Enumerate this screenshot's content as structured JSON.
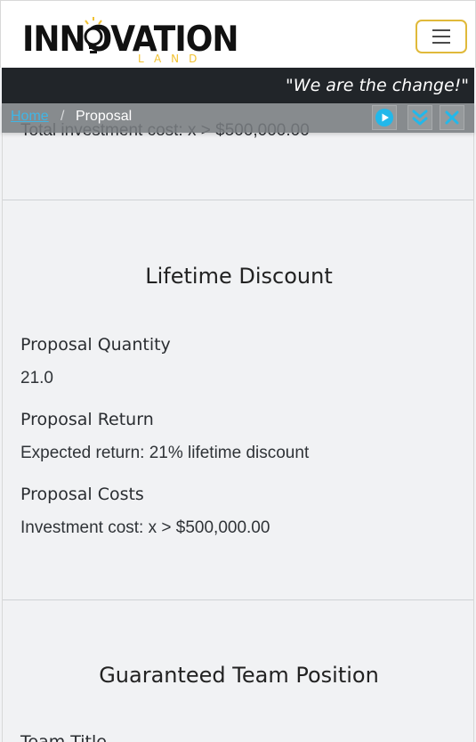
{
  "header": {
    "logo_text": "INNOVATION",
    "logo_subtext": "LAND",
    "menu_label": "Toggle navigation"
  },
  "slogan": "\"We are the change!\"",
  "breadcrumb": {
    "home": "Home",
    "separator": "/",
    "current": "Proposal"
  },
  "controls": {
    "play_icon": "play-circle-icon",
    "expand_icon": "double-chevron-down-icon",
    "close_icon": "close-icon"
  },
  "previous_section": {
    "cut_text": "Total investment cost: x > $500,000.00"
  },
  "sections": [
    {
      "title": "Lifetime Discount",
      "fields": [
        {
          "label": "Proposal Quantity",
          "value": "21.0"
        },
        {
          "label": "Proposal Return",
          "value": "Expected return: 21% lifetime discount"
        },
        {
          "label": "Proposal Costs",
          "value": "Investment cost: x > $500,000.00"
        }
      ]
    },
    {
      "title": "Guaranteed Team Position",
      "fields": [
        {
          "label": "Team Title",
          "value": ""
        }
      ]
    }
  ],
  "colors": {
    "accent": "#e0b93a",
    "link": "#3fb6e6",
    "dark_bar": "#212529",
    "background": "#f1f2f4"
  }
}
